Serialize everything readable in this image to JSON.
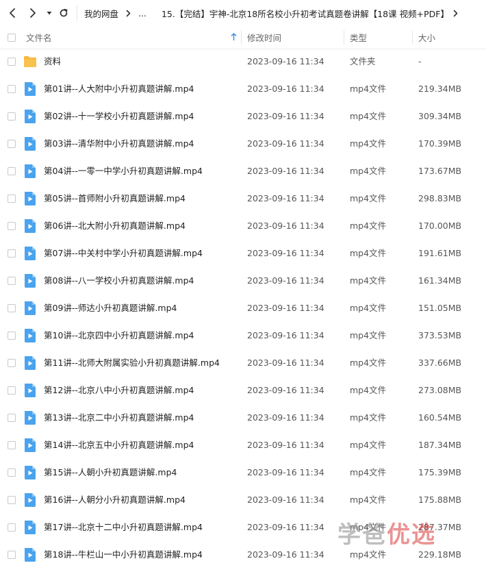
{
  "toolbar": {
    "back_icon": "chevron-left-icon",
    "forward_icon": "chevron-right-icon",
    "history_icon": "caret-down-icon",
    "refresh_icon": "refresh-icon"
  },
  "breadcrumb": {
    "root": "我的网盘",
    "ellipsis": "...",
    "current": "15.【完结】宇神-北京18所名校小升初考试真题卷讲解【18课 视频+PDF】"
  },
  "columns": {
    "name": "文件名",
    "modified": "修改时间",
    "type": "类型",
    "size": "大小"
  },
  "colors": {
    "accent": "#3d8fe6",
    "folder": "#f6b73c",
    "video_icon": "#4aa3ee",
    "watermark_red": "#d83b3b"
  },
  "files": [
    {
      "name": "资料",
      "modified": "2023-09-16 11:34",
      "type": "文件夹",
      "size": "-",
      "icon": "folder-icon"
    },
    {
      "name": "第01讲--人大附中小升初真题讲解.mp4",
      "modified": "2023-09-16 11:34",
      "type": "mp4文件",
      "size": "219.34MB",
      "icon": "video-file-icon"
    },
    {
      "name": "第02讲--十一学校小升初真题讲解.mp4",
      "modified": "2023-09-16 11:34",
      "type": "mp4文件",
      "size": "309.34MB",
      "icon": "video-file-icon"
    },
    {
      "name": "第03讲--清华附中小升初真题讲解.mp4",
      "modified": "2023-09-16 11:34",
      "type": "mp4文件",
      "size": "170.39MB",
      "icon": "video-file-icon"
    },
    {
      "name": "第04讲--一零一中学小升初真题讲解.mp4",
      "modified": "2023-09-16 11:34",
      "type": "mp4文件",
      "size": "173.67MB",
      "icon": "video-file-icon"
    },
    {
      "name": "第05讲--首师附小升初真题讲解.mp4",
      "modified": "2023-09-16 11:34",
      "type": "mp4文件",
      "size": "298.83MB",
      "icon": "video-file-icon"
    },
    {
      "name": "第06讲--北大附小升初真题讲解.mp4",
      "modified": "2023-09-16 11:34",
      "type": "mp4文件",
      "size": "170.00MB",
      "icon": "video-file-icon"
    },
    {
      "name": "第07讲--中关村中学小升初真题讲解.mp4",
      "modified": "2023-09-16 11:34",
      "type": "mp4文件",
      "size": "191.61MB",
      "icon": "video-file-icon"
    },
    {
      "name": "第08讲--八一学校小升初真题讲解.mp4",
      "modified": "2023-09-16 11:34",
      "type": "mp4文件",
      "size": "161.34MB",
      "icon": "video-file-icon"
    },
    {
      "name": "第09讲--师达小升初真题讲解.mp4",
      "modified": "2023-09-16 11:34",
      "type": "mp4文件",
      "size": "151.05MB",
      "icon": "video-file-icon"
    },
    {
      "name": "第10讲--北京四中小升初真题讲解.mp4",
      "modified": "2023-09-16 11:34",
      "type": "mp4文件",
      "size": "373.53MB",
      "icon": "video-file-icon"
    },
    {
      "name": "第11讲--北师大附属实验小升初真题讲解.mp4",
      "modified": "2023-09-16 11:34",
      "type": "mp4文件",
      "size": "337.66MB",
      "icon": "video-file-icon"
    },
    {
      "name": "第12讲--北京八中小升初真题讲解.mp4",
      "modified": "2023-09-16 11:34",
      "type": "mp4文件",
      "size": "273.08MB",
      "icon": "video-file-icon"
    },
    {
      "name": "第13讲--北京二中小升初真题讲解.mp4",
      "modified": "2023-09-16 11:34",
      "type": "mp4文件",
      "size": "160.54MB",
      "icon": "video-file-icon"
    },
    {
      "name": "第14讲--北京五中小升初真题讲解.mp4",
      "modified": "2023-09-16 11:34",
      "type": "mp4文件",
      "size": "187.34MB",
      "icon": "video-file-icon"
    },
    {
      "name": "第15讲--人朝小升初真题讲解.mp4",
      "modified": "2023-09-16 11:34",
      "type": "mp4文件",
      "size": "175.39MB",
      "icon": "video-file-icon"
    },
    {
      "name": "第16讲--人朝分小升初真题讲解.mp4",
      "modified": "2023-09-16 11:34",
      "type": "mp4文件",
      "size": "175.88MB",
      "icon": "video-file-icon"
    },
    {
      "name": "第17讲--北京十二中小升初真题讲解.mp4",
      "modified": "2023-09-16 11:34",
      "type": "mp4文件",
      "size": "287.37MB",
      "icon": "video-file-icon"
    },
    {
      "name": "第18讲--牛栏山一中小升初真题讲解.mp4",
      "modified": "2023-09-16 11:34",
      "type": "mp4文件",
      "size": "229.18MB",
      "icon": "video-file-icon"
    }
  ],
  "watermark": {
    "part1": "学爸",
    "part2": "优选"
  }
}
